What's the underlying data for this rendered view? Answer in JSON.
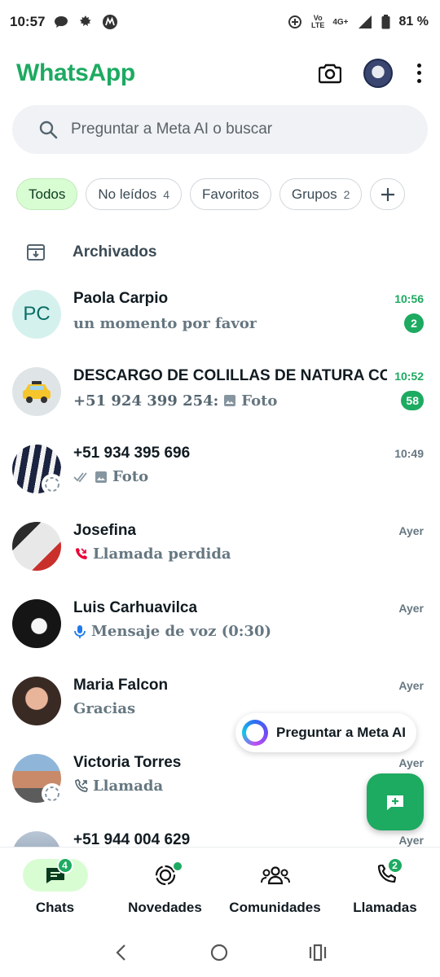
{
  "status_bar": {
    "time": "10:57",
    "volte_top": "Vo",
    "volte_bottom": "LTE",
    "network": "4G+",
    "battery": "81 %"
  },
  "header": {
    "title": "WhatsApp"
  },
  "search": {
    "placeholder": "Preguntar a Meta AI o buscar"
  },
  "filters": [
    {
      "label": "Todos",
      "count": ""
    },
    {
      "label": "No leídos",
      "count": "4"
    },
    {
      "label": "Favoritos",
      "count": ""
    },
    {
      "label": "Grupos",
      "count": "2"
    }
  ],
  "archived": {
    "label": "Archivados"
  },
  "chats": [
    {
      "name": "Paola Carpio",
      "initials": "PC",
      "time": "10:56",
      "preview": "un momento por favor",
      "sender": "",
      "badge": "2"
    },
    {
      "name": "DESCARGO DE COLILLAS DE NATURA CO",
      "initials": "",
      "time": "10:52",
      "preview": "Foto",
      "sender": "+51 924 399 254:",
      "badge": "58"
    },
    {
      "name": "+51 934 395 696",
      "initials": "",
      "time": "10:49",
      "preview": "Foto",
      "sender": "",
      "badge": ""
    },
    {
      "name": "Josefina",
      "initials": "",
      "time": "Ayer",
      "preview": "Llamada perdida",
      "sender": "",
      "badge": ""
    },
    {
      "name": "Luis Carhuavilca",
      "initials": "",
      "time": "Ayer",
      "preview": "Mensaje de voz (0:30)",
      "sender": "",
      "badge": ""
    },
    {
      "name": "Maria Falcon",
      "initials": "",
      "time": "Ayer",
      "preview": "Gracias",
      "sender": "",
      "badge": ""
    },
    {
      "name": "Victoria Torres",
      "initials": "",
      "time": "Ayer",
      "preview": "Llamada",
      "sender": "",
      "badge": ""
    },
    {
      "name": "+51 944 004 629",
      "initials": "",
      "time": "Ayer",
      "preview": "",
      "sender": "",
      "badge": ""
    }
  ],
  "meta_ai": {
    "label": "Preguntar a Meta AI"
  },
  "bottom_nav": [
    {
      "label": "Chats",
      "badge": "4"
    },
    {
      "label": "Novedades",
      "badge": ""
    },
    {
      "label": "Comunidades",
      "badge": ""
    },
    {
      "label": "Llamadas",
      "badge": "2"
    }
  ],
  "colors": {
    "brand_green": "#1daa61",
    "chip_active_bg": "#d9fdd3"
  }
}
